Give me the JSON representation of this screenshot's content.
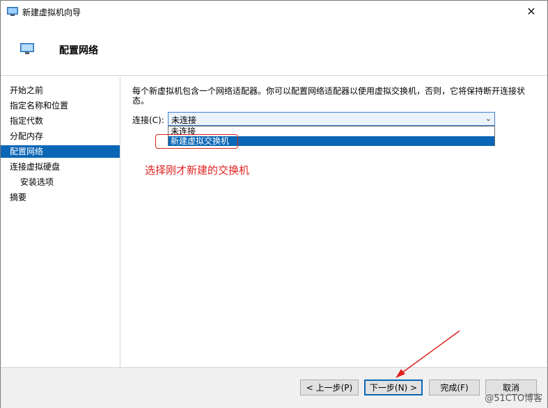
{
  "window": {
    "title": "新建虚拟机向导",
    "close_glyph": "✕"
  },
  "header": {
    "title": "配置网络"
  },
  "sidebar": {
    "items": [
      {
        "label": "开始之前"
      },
      {
        "label": "指定名称和位置"
      },
      {
        "label": "指定代数"
      },
      {
        "label": "分配内存"
      },
      {
        "label": "配置网络"
      },
      {
        "label": "连接虚拟硬盘"
      },
      {
        "label": "安装选项"
      },
      {
        "label": "摘要"
      }
    ],
    "active_index": 4
  },
  "content": {
    "description": "每个新虚拟机包含一个网络适配器。你可以配置网络适配器以使用虚拟交换机，否则，它将保持断开连接状态。",
    "connection_label": "连接(C):",
    "connection_value": "未连接",
    "options": [
      "未连接",
      "新建虚拟交换机"
    ],
    "selected_option": "新建虚拟交换机",
    "annotation": "选择刚才新建的交换机"
  },
  "footer": {
    "back_label": "< 上一步(P)",
    "next_label": "下一步(N) >",
    "finish_label": "完成(F)",
    "cancel_label": "取消"
  },
  "watermark": "@51CTO博客",
  "colors": {
    "accent": "#0b66b6",
    "annotation": "#e02020"
  }
}
